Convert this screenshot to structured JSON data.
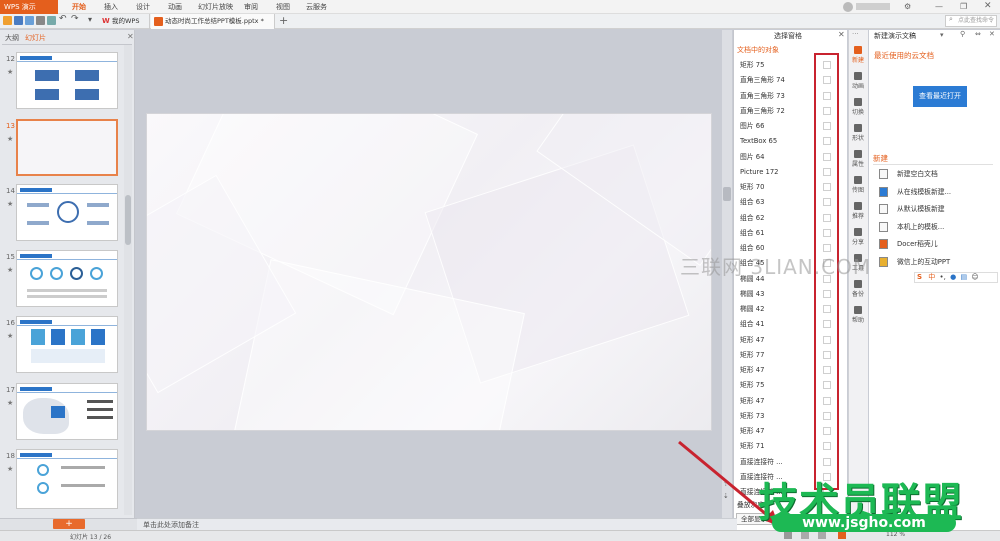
{
  "menubar": {
    "app_name": "WPS 演示",
    "items": [
      "开始",
      "插入",
      "设计",
      "动画",
      "幻灯片放映",
      "审阅",
      "视图",
      "云服务"
    ],
    "search_placeholder": "点此查找命令",
    "user": "用户"
  },
  "tabs": [
    "我的WPS",
    "动态时尚工作总结PPT模板.pptx *"
  ],
  "left_panel": {
    "tab_outline": "大纲",
    "tab_slides": "幻灯片",
    "slide_numbers": [
      "12",
      "13",
      "14",
      "15",
      "16",
      "17",
      "18"
    ],
    "add_button": "+"
  },
  "selection_pane": {
    "title": "选择窗格",
    "subtitle": "文档中的对象",
    "items": [
      "矩形 75",
      "直角三角形 74",
      "直角三角形 73",
      "直角三角形 72",
      "图片 66",
      "TextBox 65",
      "图片 64",
      "Picture 172",
      "矩形 70",
      "组合 63",
      "组合 62",
      "组合 61",
      "组合 60",
      "组合 45",
      "椭圆 44",
      "椭圆 43",
      "椭圆 42",
      "组合 41",
      "矩形 47",
      "矩形 77",
      "矩形 47",
      "矩形 75",
      "矩形 47",
      "矩形 73",
      "矩形 47",
      "矩形 71",
      "直接连接符 ...",
      "直接连接符 ...",
      "直接连接符 ..."
    ],
    "reorder_label": "叠放次序",
    "show_all": "全部显示"
  },
  "icon_bar": [
    "新建",
    "动画",
    "切换",
    "形状",
    "属性",
    "传图",
    "推荐",
    "分享",
    "工具",
    "备份",
    "帮助"
  ],
  "right_panel": {
    "title": "新建演示文稿",
    "recent_label": "最近使用的云文档",
    "view_recent_button": "查看最近打开",
    "new_label": "新建",
    "new_items": [
      "新建空白文档",
      "从在线模板新建...",
      "从默认模板新建",
      "本机上的模板...",
      "Docer稻壳儿",
      "微信上的互动PPT"
    ]
  },
  "notes_placeholder": "单击此处添加备注",
  "status": {
    "slide_counter": "幻灯片 13 / 26",
    "zoom": "112 %"
  },
  "watermark": "三联网 3LIAN.COM",
  "brand": {
    "name": "技术员联盟",
    "url": "www.jsgho.com"
  }
}
